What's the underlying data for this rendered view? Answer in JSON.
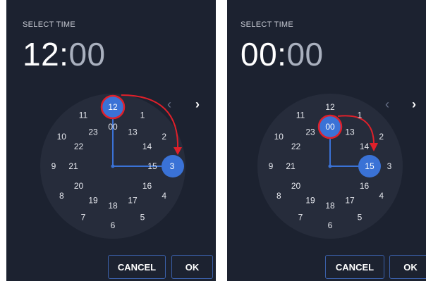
{
  "panels": [
    {
      "label": "SELECT TIME",
      "hours": "12",
      "separator": ":",
      "minutes": "00",
      "prev": "‹",
      "next": "›",
      "outer_numbers": [
        "12",
        "1",
        "2",
        "3",
        "4",
        "5",
        "6",
        "7",
        "8",
        "9",
        "10",
        "11"
      ],
      "inner_numbers": [
        "00",
        "13",
        "14",
        "15",
        "16",
        "17",
        "18",
        "19",
        "20",
        "21",
        "22",
        "23"
      ],
      "selected_outer": "12",
      "selected_target": "3",
      "cancel": "CANCEL",
      "ok": "OK",
      "accent_color": "#3a72d6",
      "arrow_color": "#e0202a"
    },
    {
      "label": "SELECT TIME",
      "hours": "00",
      "separator": ":",
      "minutes": "00",
      "prev": "‹",
      "next": "›",
      "outer_numbers": [
        "12",
        "1",
        "2",
        "3",
        "4",
        "5",
        "6",
        "7",
        "8",
        "9",
        "10",
        "11"
      ],
      "inner_numbers": [
        "00",
        "13",
        "14",
        "15",
        "16",
        "17",
        "18",
        "19",
        "20",
        "21",
        "22",
        "23"
      ],
      "selected_inner": "00",
      "selected_target": "15",
      "cancel": "CANCEL",
      "ok": "OK",
      "accent_color": "#3a72d6",
      "arrow_color": "#e0202a"
    }
  ]
}
